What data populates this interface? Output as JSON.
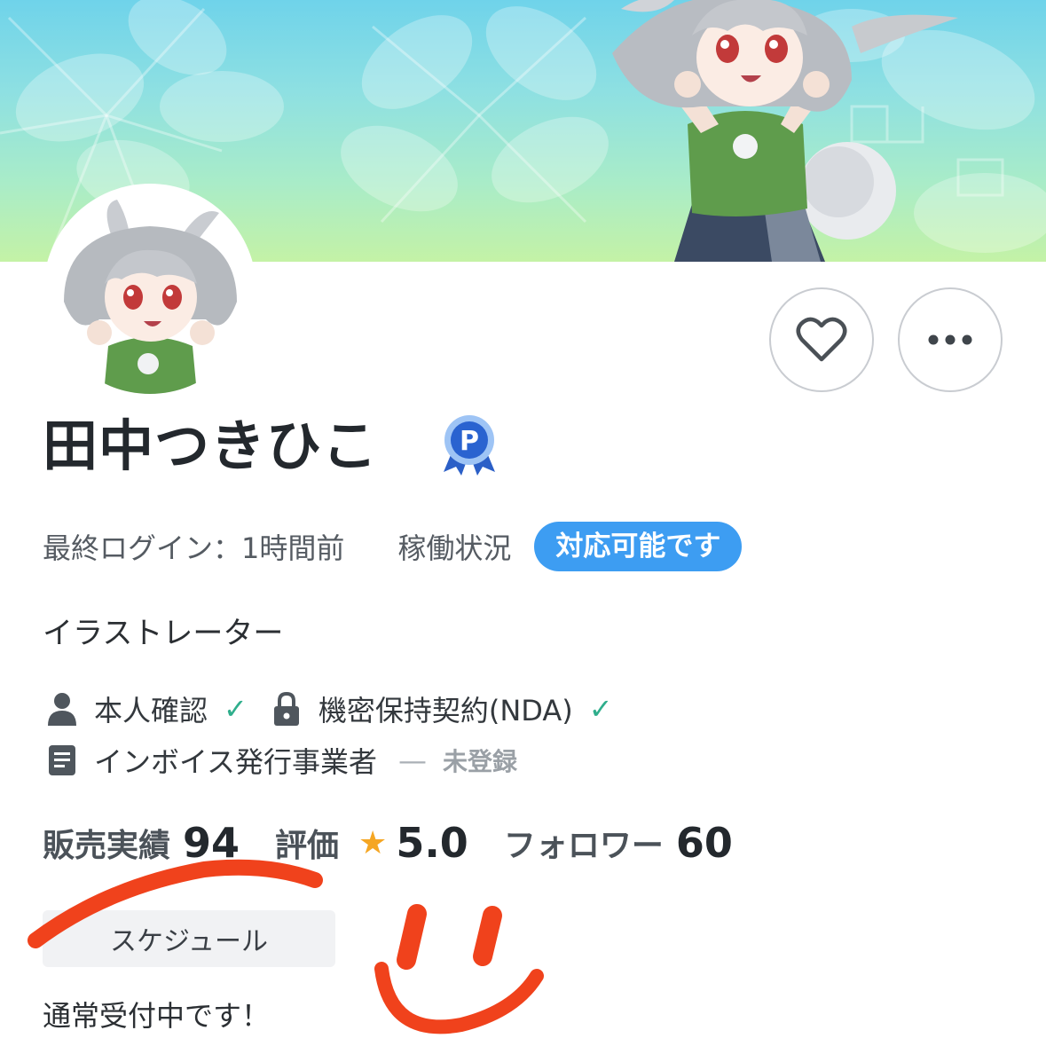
{
  "profile": {
    "name": "田中つきひこ",
    "badge_letter": "P",
    "last_login": "最終ログイン：1時間前",
    "status_label": "稼働状況",
    "status_value": "対応可能です",
    "role": "イラストレーター"
  },
  "verifications": {
    "identity": "本人確認",
    "nda": "機密保持契約(NDA)",
    "invoice": "インボイス発行事業者",
    "invoice_dash": "—",
    "invoice_status": "未登録",
    "check_mark": "✓"
  },
  "stats": {
    "sales_label": "販売実績",
    "sales_value": "94",
    "rating_label": "評価",
    "rating_value": "5.0",
    "followers_label": "フォロワー",
    "followers_value": "60"
  },
  "schedule": {
    "label": "スケジュール",
    "note": "通常受付中です！"
  },
  "icons": {
    "favorite": "heart-icon",
    "more": "more-dots-icon",
    "identity": "person-icon",
    "nda": "lock-icon",
    "invoice": "document-icon",
    "rating": "star-icon"
  },
  "colors": {
    "accent_blue": "#3d9df2",
    "check_green": "#2fae8c",
    "star_orange": "#f5a623",
    "scribble_red": "#f0421c"
  }
}
